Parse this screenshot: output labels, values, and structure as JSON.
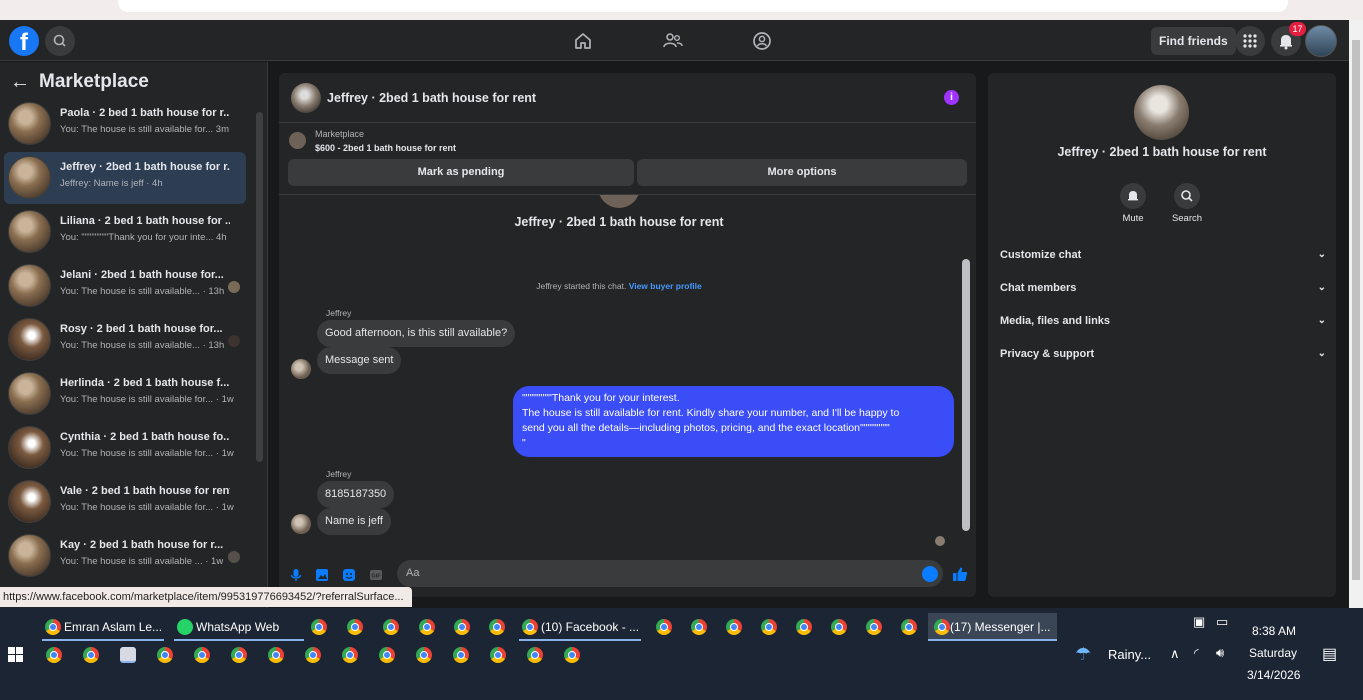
{
  "header": {
    "logo": "f",
    "find_friends": "Find friends",
    "notification_count": "17"
  },
  "left_pane": {
    "title": "Marketplace",
    "conversations": [
      {
        "title": "Paola · 2 bed 1 bath house for r...",
        "subtitle": "You: The house is still available for...  3m"
      },
      {
        "title": "Jeffrey · 2bed 1 bath house for r...",
        "subtitle": "Jeffrey: Name is jeff · 4h"
      },
      {
        "title": "Liliana · 2 bed 1 bath house for ...",
        "subtitle": "You: \"\"\"\"\"\"\"\"Thank you for your inte...  4h"
      },
      {
        "title": "Jelani · 2bed 1 bath house for...",
        "subtitle": "You: The house is still available... · 13h"
      },
      {
        "title": "Rosy · 2 bed 1 bath house for...",
        "subtitle": "You: The house is still available... · 13h"
      },
      {
        "title": "Herlinda · 2 bed 1 bath house f...",
        "subtitle": "You: The house is still available for... · 1w"
      },
      {
        "title": "Cynthia · 2 bed 1 bath house fo...",
        "subtitle": "You: The house is still available for... · 1w"
      },
      {
        "title": "Vale · 2 bed 1 bath house for rent",
        "subtitle": "You: The house is still available for... · 1w"
      },
      {
        "title": "Kay · 2 bed 1 bath house for r...",
        "subtitle": "You: The house is still available ... · 1w"
      }
    ]
  },
  "chat": {
    "header_title": "Jeffrey · 2bed 1 bath house for rent",
    "marketplace_label": "Marketplace",
    "listing": "$600 - 2bed 1 bath house for rent",
    "mark_pending": "Mark as pending",
    "more_options": "More options",
    "conversation_title": "Jeffrey · 2bed 1 bath house for rent",
    "started_text": "Jeffrey started this chat.",
    "view_buyer_profile": "View buyer profile",
    "sender_1": "Jeffrey",
    "msg_1": "Good afternoon, is this still available?",
    "msg_2": "Message sent",
    "outgoing": "\"\"\"\"\"\"\"\"Thank you for your interest.\nThe house is still available for rent. Kindly share your number, and I'll be happy to\nsend you all the details—including photos, pricing, and the exact location\"\"\"\"\"\"\"\"\n\"",
    "sender_2": "Jeffrey",
    "msg_3": "8185187350",
    "msg_4": "Name is jeff",
    "composer_placeholder": "Aa"
  },
  "right_pane": {
    "name": "Jeffrey · 2bed 1 bath house for rent",
    "mute": "Mute",
    "search": "Search",
    "rows": [
      "Customize chat",
      "Chat members",
      "Media, files and links",
      "Privacy & support"
    ]
  },
  "status_url": "https://www.facebook.com/marketplace/item/995319776693452/?referralSurface...",
  "taskbar": {
    "items": [
      {
        "label": "Emran Aslam Le..."
      },
      {
        "label": "WhatsApp Web"
      },
      {
        "label": "(10) Facebook - ..."
      },
      {
        "label": "(17) Messenger |..."
      }
    ],
    "weather": "Rainy...",
    "time": "8:38 AM",
    "day": "Saturday",
    "date": "3/14/2026"
  }
}
